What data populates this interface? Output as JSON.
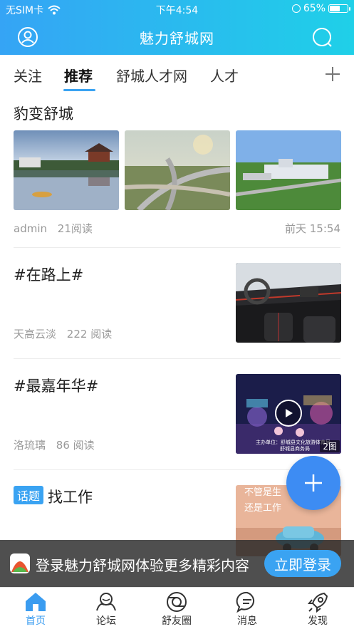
{
  "status_bar": {
    "carrier": "无SIM卡",
    "time": "下午4:54",
    "battery": "65%",
    "battery_level": 0.65
  },
  "app": {
    "title": "魅力舒城网"
  },
  "tabs": [
    {
      "label": "关注"
    },
    {
      "label": "推荐"
    },
    {
      "label": "舒城人才网"
    },
    {
      "label": "人才"
    }
  ],
  "posts": [
    {
      "title": "豹变舒城",
      "author": "admin",
      "reads": "21阅读",
      "time": "前天 15:54"
    },
    {
      "title": "#在路上#",
      "author": "天高云淡",
      "reads": "222 阅读"
    },
    {
      "title": "#最嘉年华#",
      "author": "洛琉璃",
      "reads": "86 阅读",
      "image_count": "2图",
      "video_caption_1": "主办单位：舒城县文化旅游体育局",
      "video_caption_2": "舒城县商务局"
    },
    {
      "badge": "话题",
      "title": "找工作",
      "image_text_1": "不管是生",
      "image_text_2": "还是工作"
    }
  ],
  "banner": {
    "text": "登录魅力舒城网体验更多精彩内容",
    "login": "立即登录"
  },
  "nav": [
    {
      "label": "首页"
    },
    {
      "label": "论坛"
    },
    {
      "label": "舒友圈"
    },
    {
      "label": "消息"
    },
    {
      "label": "发现"
    }
  ],
  "colors": {
    "accent": "#3aa3f2",
    "header_start": "#35a4f5",
    "header_end": "#1fd0e8",
    "fab": "#3d8cf3"
  }
}
